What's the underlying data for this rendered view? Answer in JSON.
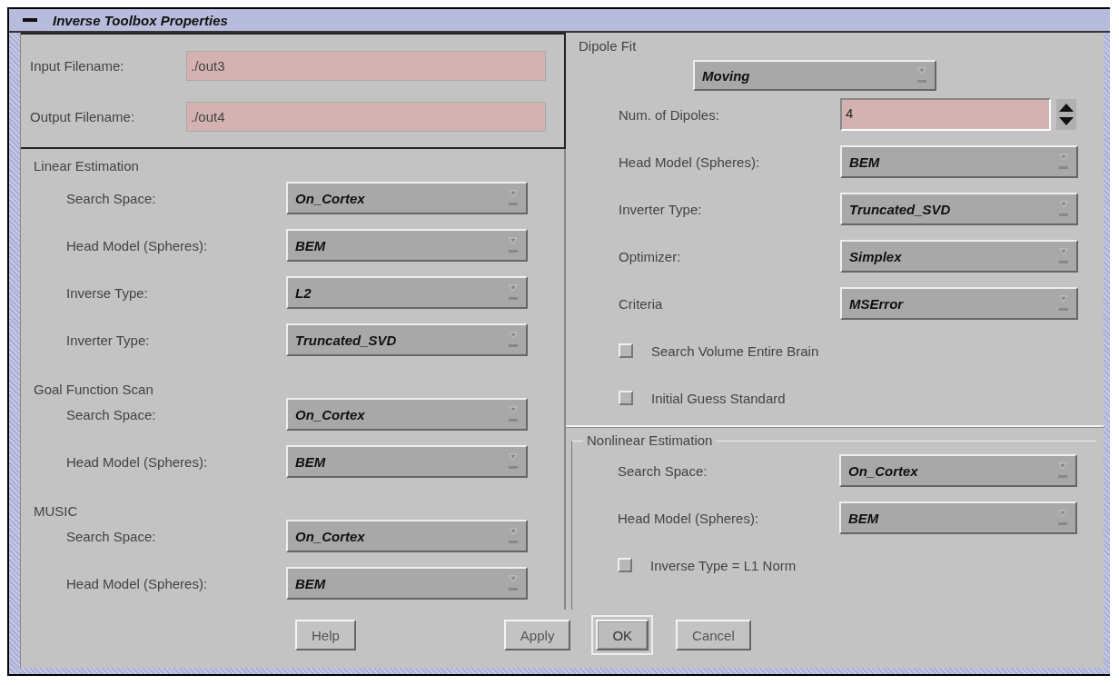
{
  "window": {
    "title": "Inverse Toolbox Properties"
  },
  "files": [
    {
      "label": "Input Filename:",
      "value": "./out3"
    },
    {
      "label": "Output Filename:",
      "value": "./out4"
    }
  ],
  "left_sections": [
    {
      "title": "Linear Estimation",
      "rows": [
        {
          "kind": "combo",
          "label": "Search Space:",
          "value": "On_Cortex"
        },
        {
          "kind": "combo",
          "label": "Head Model (Spheres):",
          "value": "BEM"
        },
        {
          "kind": "combo",
          "label": "Inverse Type:",
          "value": "L2"
        },
        {
          "kind": "combo",
          "label": "Inverter Type:",
          "value": "Truncated_SVD"
        }
      ]
    },
    {
      "title": "Goal Function Scan",
      "rows": [
        {
          "kind": "combo",
          "label": "Search Space:",
          "value": "On_Cortex"
        },
        {
          "kind": "combo",
          "label": "Head Model (Spheres):",
          "value": "BEM"
        }
      ]
    },
    {
      "title": "MUSIC",
      "rows": [
        {
          "kind": "combo",
          "label": "Search Space:",
          "value": "On_Cortex"
        },
        {
          "kind": "combo",
          "label": "Head Model (Spheres):",
          "value": "BEM"
        }
      ]
    }
  ],
  "dipole_fit": {
    "title": "Dipole Fit",
    "mode": "Moving",
    "rows": [
      {
        "kind": "spinner",
        "label": "Num. of Dipoles:",
        "value": "4"
      },
      {
        "kind": "combo",
        "label": "Head Model (Spheres):",
        "value": "BEM"
      },
      {
        "kind": "combo",
        "label": "Inverter Type:",
        "value": "Truncated_SVD"
      },
      {
        "kind": "combo",
        "label": "Optimizer:",
        "value": "Simplex"
      },
      {
        "kind": "combo",
        "label": "Criteria",
        "value": "MSError"
      },
      {
        "kind": "checkbox",
        "label": "Search Volume Entire Brain",
        "checked": false
      },
      {
        "kind": "checkbox",
        "label": "Initial Guess Standard",
        "checked": false
      }
    ]
  },
  "nonlinear": {
    "title": "Nonlinear Estimation",
    "rows": [
      {
        "kind": "combo",
        "label": "Search Space:",
        "value": "On_Cortex"
      },
      {
        "kind": "combo",
        "label": "Head Model (Spheres):",
        "value": "BEM"
      },
      {
        "kind": "checkbox",
        "label": "Inverse Type = L1 Norm",
        "checked": false
      }
    ]
  },
  "buttons": [
    {
      "label": "Help",
      "default": false
    },
    {
      "label": "Apply",
      "default": false
    },
    {
      "label": "OK",
      "default": true
    },
    {
      "label": "Cancel",
      "default": false
    }
  ]
}
